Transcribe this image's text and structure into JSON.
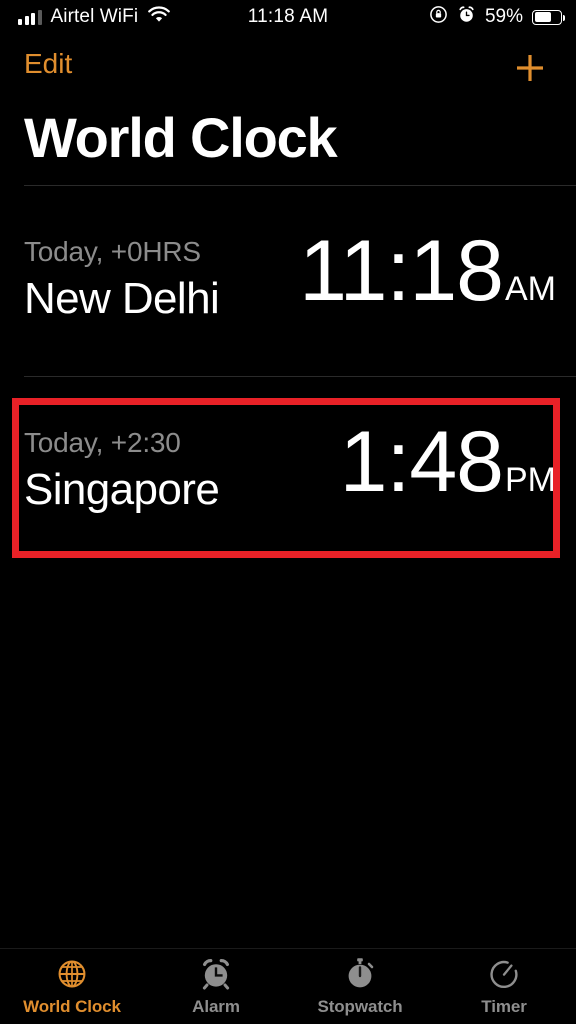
{
  "status_bar": {
    "carrier": "Airtel WiFi",
    "signal_icon": "signal-bars-icon",
    "wifi_icon": "wifi-icon",
    "time": "11:18 AM",
    "rotation_lock_icon": "rotation-lock-icon",
    "alarm_icon": "alarm-clock-icon",
    "battery_percent": "59%",
    "battery_icon": "battery-icon"
  },
  "nav_bar": {
    "edit_label": "Edit",
    "add_icon": "plus-icon",
    "accent_color": "#E08E2E"
  },
  "header": {
    "title": "World Clock"
  },
  "clocks": [
    {
      "offset": "Today, +0HRS",
      "city": "New Delhi",
      "time": "11:18",
      "ampm": "AM"
    },
    {
      "offset": "Today, +2:30",
      "city": "Singapore",
      "time": "1:48",
      "ampm": "PM"
    }
  ],
  "highlight": {
    "target_city": "Singapore",
    "color": "#E82127"
  },
  "tab_bar": {
    "tabs": [
      {
        "label": "World Clock",
        "icon": "globe-icon",
        "active": true
      },
      {
        "label": "Alarm",
        "icon": "alarm-clock-icon",
        "active": false
      },
      {
        "label": "Stopwatch",
        "icon": "stopwatch-icon",
        "active": false
      },
      {
        "label": "Timer",
        "icon": "timer-icon",
        "active": false
      }
    ],
    "active_color": "#E08E2E",
    "inactive_color": "#8E8E8E"
  }
}
